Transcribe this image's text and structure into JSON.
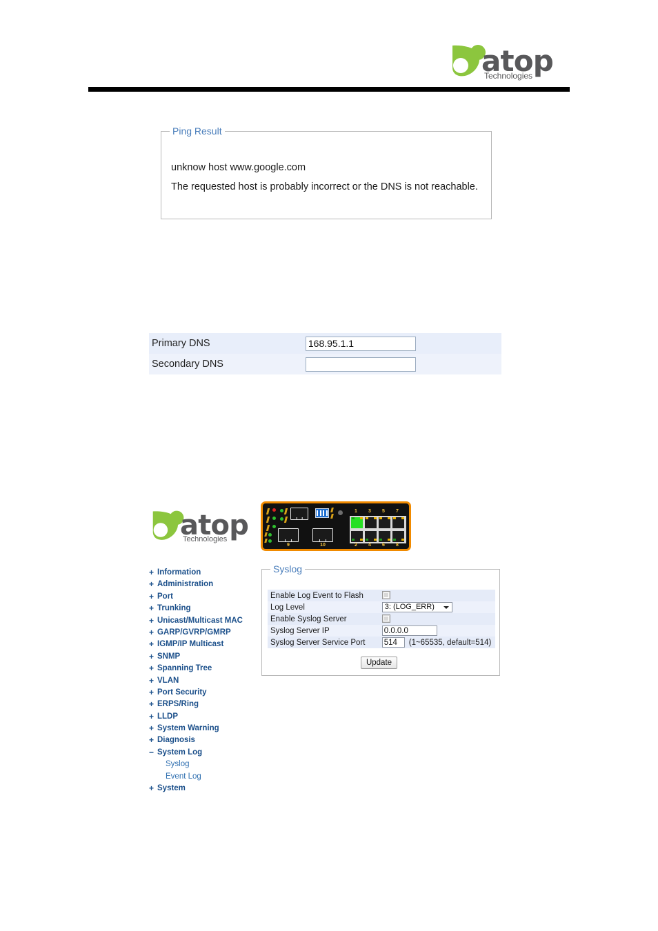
{
  "header": {
    "logo": {
      "word": "atop",
      "tagline": "Technologies",
      "mark_color": "#8cc63e",
      "word_color_dark": "#58585a",
      "word_color_green": "#8cc63e"
    }
  },
  "ping_result": {
    "legend": "Ping Result",
    "line1": "unknow host www.google.com",
    "line2": "The requested host is probably incorrect or the DNS is not reachable."
  },
  "dns_table": {
    "rows": [
      {
        "label": "Primary DNS",
        "value": "168.95.1.1"
      },
      {
        "label": "Secondary DNS",
        "value": ""
      }
    ]
  },
  "device": {
    "logo_word": "atop",
    "logo_tagline": "Technologies",
    "port_labels_top": [
      "1",
      "3",
      "5",
      "7"
    ],
    "port_labels_bottom": [
      "2",
      "4",
      "6",
      "8"
    ],
    "port_label_9": "9",
    "port_label_10": "10",
    "active_port": "1",
    "active_port_color": "#27e024",
    "bezel_color": "#f08a00"
  },
  "sidebar": {
    "items": [
      {
        "toggle": "+",
        "label": "Information"
      },
      {
        "toggle": "+",
        "label": "Administration"
      },
      {
        "toggle": "+",
        "label": "Port"
      },
      {
        "toggle": "+",
        "label": "Trunking"
      },
      {
        "toggle": "+",
        "label": "Unicast/Multicast MAC"
      },
      {
        "toggle": "+",
        "label": "GARP/GVRP/GMRP"
      },
      {
        "toggle": "+",
        "label": "IGMP/IP Multicast"
      },
      {
        "toggle": "+",
        "label": "SNMP"
      },
      {
        "toggle": "+",
        "label": "Spanning Tree"
      },
      {
        "toggle": "+",
        "label": "VLAN"
      },
      {
        "toggle": "+",
        "label": "Port Security"
      },
      {
        "toggle": "+",
        "label": "ERPS/Ring"
      },
      {
        "toggle": "+",
        "label": "LLDP"
      },
      {
        "toggle": "+",
        "label": "System Warning"
      },
      {
        "toggle": "+",
        "label": "Diagnosis"
      },
      {
        "toggle": "−",
        "label": "System Log"
      }
    ],
    "subitems": [
      {
        "label": "Syslog"
      },
      {
        "label": "Event Log"
      }
    ],
    "tail_items": [
      {
        "toggle": "+",
        "label": "System"
      }
    ]
  },
  "syslog": {
    "legend": "Syslog",
    "rows": [
      {
        "label": "Enable Log Event to Flash",
        "type": "checkbox",
        "checked": false
      },
      {
        "label": "Log Level",
        "type": "select",
        "value": "3: (LOG_ERR)"
      },
      {
        "label": "Enable Syslog Server",
        "type": "checkbox",
        "checked": false
      },
      {
        "label": "Syslog Server IP",
        "type": "text",
        "value": "0.0.0.0"
      },
      {
        "label": "Syslog Server Service Port",
        "type": "text",
        "value": "514",
        "hint": "(1~65535, default=514)"
      }
    ],
    "update_label": "Update"
  }
}
